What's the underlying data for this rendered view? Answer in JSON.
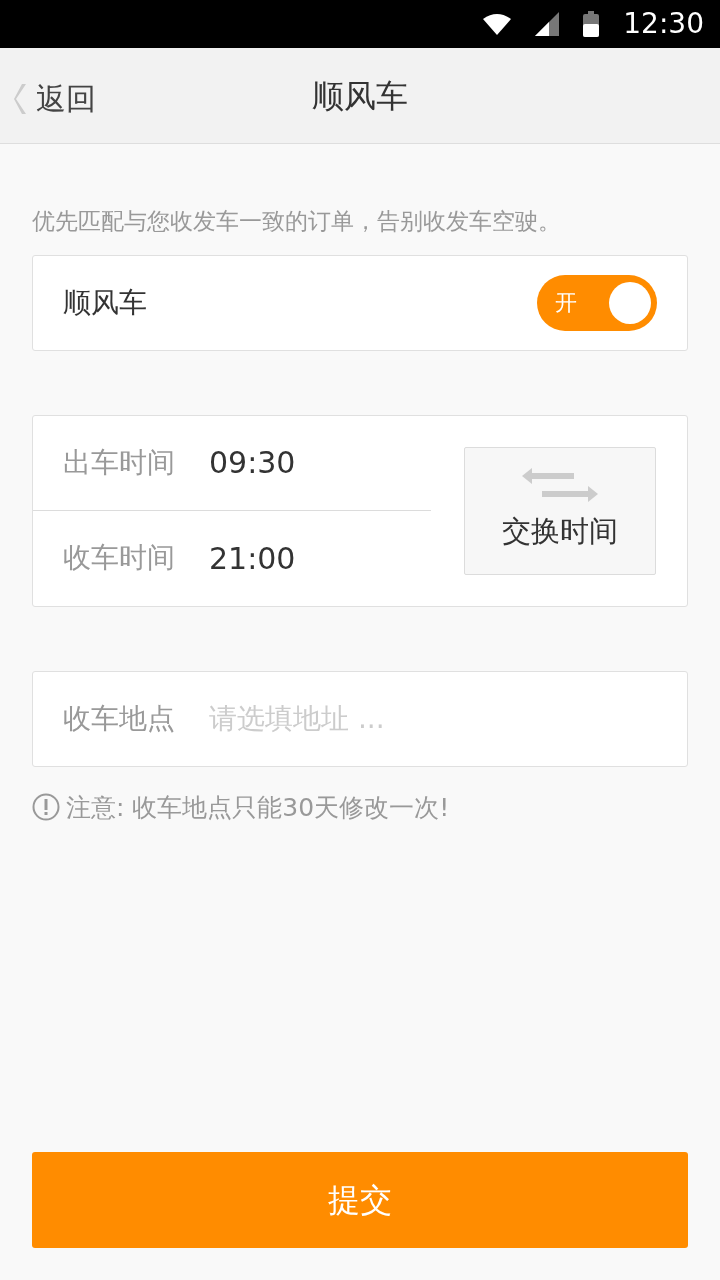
{
  "status_bar": {
    "time": "12:30"
  },
  "header": {
    "back": "返回",
    "title": "顺风车"
  },
  "description": "优先匹配与您收发车一致的订单，告别收发车空驶。",
  "ride_share": {
    "label": "顺风车",
    "toggle_label": "开",
    "on": true
  },
  "times": [
    {
      "label": "出车时间",
      "value": "09:30"
    },
    {
      "label": "收车时间",
      "value": "21:00"
    }
  ],
  "swap_button": "交换时间",
  "location": {
    "label": "收车地点",
    "placeholder": "请选填地址 ..."
  },
  "notice": "注意: 收车地点只能30天修改一次!",
  "submit": "提交"
}
